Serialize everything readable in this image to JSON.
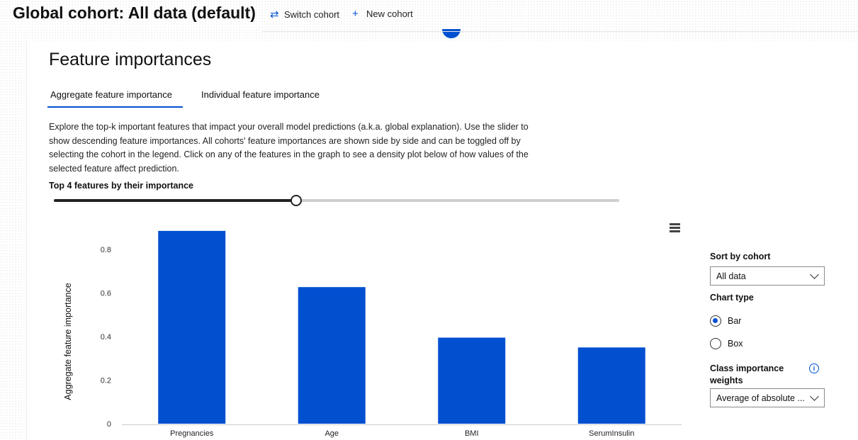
{
  "header": {
    "title": "Global cohort: All data (default)",
    "switch_label": "Switch cohort",
    "new_label": "New cohort",
    "switch_icon": "swap-arrows-icon",
    "new_icon": "plus-icon"
  },
  "section": {
    "title": "Feature importances",
    "tabs": [
      {
        "label": "Aggregate feature importance",
        "active": true
      },
      {
        "label": "Individual feature importance",
        "active": false
      }
    ],
    "description": "Explore the top-k important features that impact your overall model predictions (a.k.a. global explanation). Use the slider to show descending feature importances. All cohorts' feature importances are shown side by side and can be toggled off by selecting the cohort in the legend. Click on any of the features in the graph to see a density plot below of how values of the selected feature affect prediction.",
    "topk_label": "Top 4 features by their importance",
    "slider_value": 4
  },
  "controls": {
    "sort_label": "Sort by cohort",
    "sort_value": "All data",
    "chart_type_label": "Chart type",
    "chart_types": [
      {
        "label": "Bar",
        "selected": true
      },
      {
        "label": "Box",
        "selected": false
      }
    ],
    "class_weights_label_1": "Class importance",
    "class_weights_label_2": "weights",
    "class_weights_value": "Average of absolute ..."
  },
  "colors": {
    "accent": "#0050d0",
    "bar": "#0050d0"
  },
  "chart_data": {
    "type": "bar",
    "categories": [
      "Pregnancies",
      "Age",
      "BMI",
      "SerumInsulin"
    ],
    "values": [
      0.885,
      0.627,
      0.395,
      0.35
    ],
    "ylabel": "Aggregate feature importance",
    "xlabel": "",
    "ylim": [
      0,
      0.9
    ],
    "yticks": [
      "0",
      "0.2",
      "0.4",
      "0.6",
      "0.8"
    ],
    "ytick_values": [
      0,
      0.2,
      0.4,
      0.6,
      0.8
    ],
    "grid": false
  }
}
